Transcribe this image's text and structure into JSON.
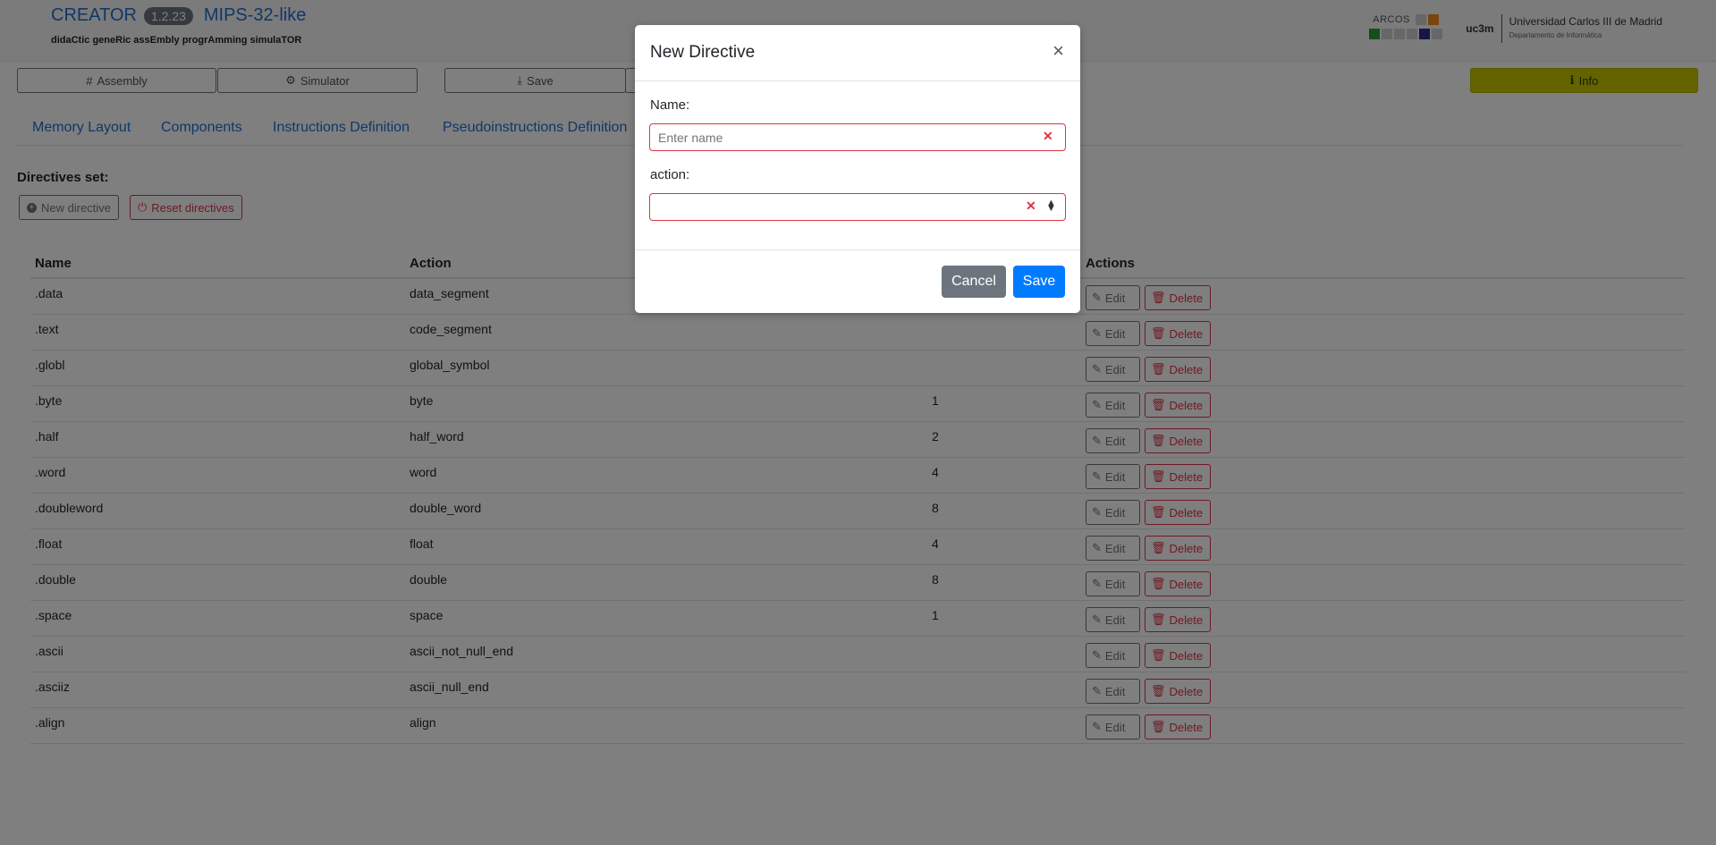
{
  "header": {
    "app_name": "CREATOR",
    "version": "1.2.23",
    "architecture": "MIPS-32-like",
    "tagline": "didaCtic geneRic assEmbly progrAmming simulaTOR",
    "arcos_logo": "ARCOS",
    "uc3m_mark": "uc3m",
    "university": "Universidad Carlos III de Madrid",
    "department": "Departamento de Informática"
  },
  "toolbar": {
    "assembly_label": "Assembly",
    "simulator_label": "Simulator",
    "save_label": "Save",
    "info_label": "Info",
    "icons": {
      "assembly": "hash-icon",
      "simulator": "gears-icon",
      "save": "download-icon",
      "info": "info-circle-icon"
    }
  },
  "nav": {
    "tabs": [
      {
        "label": "Memory Layout"
      },
      {
        "label": "Components"
      },
      {
        "label": "Instructions Definition"
      },
      {
        "label": "Pseudoinstructions Definition"
      }
    ]
  },
  "directives": {
    "title": "Directives set:",
    "new_label": "New directive",
    "reset_label": "Reset directives",
    "columns": [
      "Name",
      "Action",
      "Actions"
    ],
    "edit_label": "Edit",
    "delete_label": "Delete",
    "rows": [
      {
        "name": ".data",
        "action": "data_segment",
        "size": ""
      },
      {
        "name": ".text",
        "action": "code_segment",
        "size": ""
      },
      {
        "name": ".globl",
        "action": "global_symbol",
        "size": ""
      },
      {
        "name": ".byte",
        "action": "byte",
        "size": "1"
      },
      {
        "name": ".half",
        "action": "half_word",
        "size": "2"
      },
      {
        "name": ".word",
        "action": "word",
        "size": "4"
      },
      {
        "name": ".doubleword",
        "action": "double_word",
        "size": "8"
      },
      {
        "name": ".float",
        "action": "float",
        "size": "4"
      },
      {
        "name": ".double",
        "action": "double",
        "size": "8"
      },
      {
        "name": ".space",
        "action": "space",
        "size": "1"
      },
      {
        "name": ".ascii",
        "action": "ascii_not_null_end",
        "size": ""
      },
      {
        "name": ".asciiz",
        "action": "ascii_null_end",
        "size": ""
      },
      {
        "name": ".align",
        "action": "align",
        "size": ""
      }
    ]
  },
  "modal": {
    "title": "New Directive",
    "name_label": "Name:",
    "name_placeholder": "Enter name",
    "name_value": "",
    "action_label": "action:",
    "action_value": "",
    "cancel_label": "Cancel",
    "save_label": "Save"
  },
  "colors": {
    "primary": "#007bff",
    "danger": "#dc3545",
    "secondary": "#6c757d",
    "info": "#c6c600",
    "link": "#1f6fd1"
  }
}
